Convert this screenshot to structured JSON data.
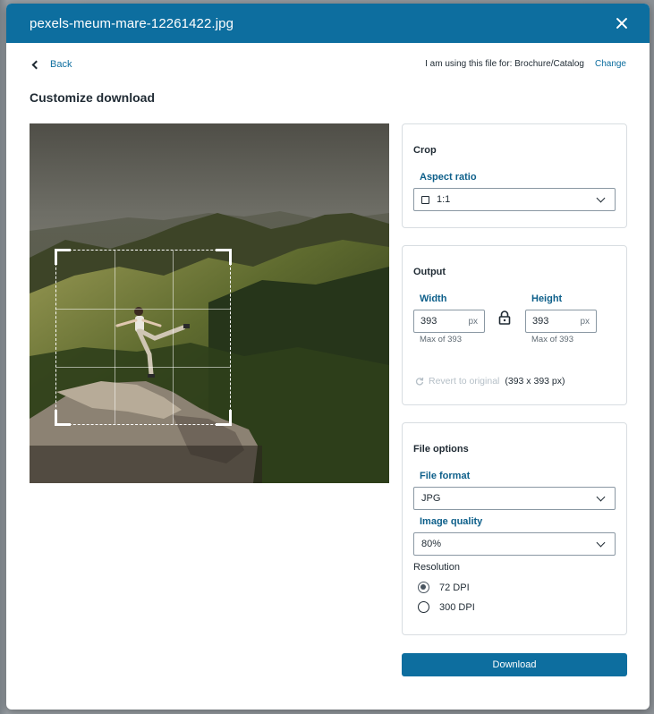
{
  "dialog": {
    "title": "pexels-meum-mare-12261422.jpg",
    "close_icon": "close-icon"
  },
  "topbar": {
    "back_label": "Back",
    "usage_text": "I am using this file for: Brochure/Catalog",
    "change_label": "Change"
  },
  "heading": "Customize download",
  "crop": {
    "title": "Crop",
    "aspect_label": "Aspect ratio",
    "aspect_value": "1:1"
  },
  "output": {
    "title": "Output",
    "width_label": "Width",
    "width_value": "393",
    "width_unit": "px",
    "width_max": "Max of 393",
    "height_label": "Height",
    "height_value": "393",
    "height_unit": "px",
    "height_max": "Max of 393",
    "revert_label": "Revert to original",
    "original_size": "(393 x 393 px)"
  },
  "file_options": {
    "title": "File options",
    "format_label": "File format",
    "format_value": "JPG",
    "quality_label": "Image quality",
    "quality_value": "80%",
    "resolution_label": "Resolution",
    "resolution_options": [
      "72 DPI",
      "300 DPI"
    ],
    "resolution_selected": "72 DPI"
  },
  "download_label": "Download",
  "colors": {
    "accent": "#0d6e9f",
    "header": "#0d6e9f"
  }
}
